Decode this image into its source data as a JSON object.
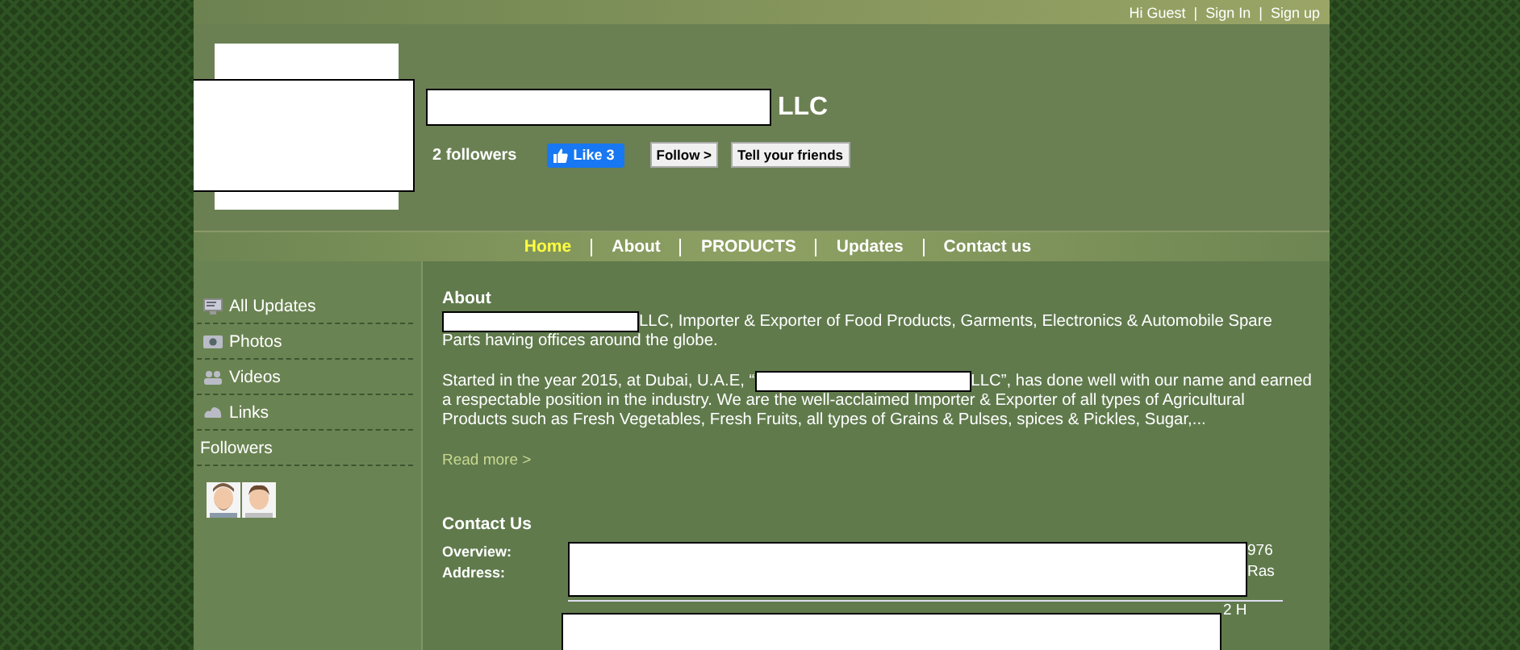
{
  "top_bar": {
    "greeting": "Hi Guest",
    "links": [
      "Sign In",
      "Sign up"
    ],
    "separators": [
      "|",
      "|"
    ]
  },
  "header": {
    "company_suffix": "LLC",
    "followers": "2 followers",
    "like_button": "Like 3",
    "buttons": [
      "Follow >",
      "Tell your friends"
    ]
  },
  "nav": [
    {
      "label": "Home",
      "selected": true
    },
    {
      "label": "About",
      "selected": false
    },
    {
      "label": "PRODUCTS",
      "selected": false
    },
    {
      "label": "Updates",
      "selected": false
    },
    {
      "label": "Contact us",
      "selected": false
    }
  ],
  "sidebar": {
    "items": [
      {
        "label": "All Updates",
        "kind": "updates"
      },
      {
        "label": "Photos",
        "kind": "photos"
      },
      {
        "label": "Videos",
        "kind": "videos"
      },
      {
        "label": "Links",
        "kind": "links"
      },
      {
        "label": "Followers",
        "kind": "plain"
      }
    ],
    "avatars": [
      {
        "kind": "bearded"
      },
      {
        "kind": "plain"
      }
    ]
  },
  "about": {
    "heading": "About",
    "paragraphs": [
      [
        [
          {
            "kind": "redacted"
          },
          {
            "kind": "text",
            "text": "LLC, Importer & Exporter of Food Products, Garments, Electronics & Automobile Spare"
          }
        ],
        [
          {
            "kind": "text",
            "text": "Parts having offices around the globe."
          }
        ]
      ],
      [
        [
          {
            "kind": "text",
            "text": "Started in the year 2015, at Dubai, U.A.E, “"
          },
          {
            "kind": "redacted"
          },
          {
            "kind": "text",
            "text": "LLC”, has done well with our name and earned"
          }
        ],
        [
          {
            "kind": "text",
            "text": "a respectable position in the industry. We are the well-acclaimed Importer & Exporter of all types of Agricultural"
          }
        ],
        [
          {
            "kind": "text",
            "text": "Products such as Fresh Vegetables, Fresh Fruits, all types of Grains & Pulses, spices & Pickles, Sugar,..."
          }
        ]
      ]
    ],
    "read_more": "Read more >"
  },
  "contact": {
    "heading": "Contact Us",
    "rows": [
      {
        "label": "Overview:",
        "value_tail": "976"
      },
      {
        "label": "Address:",
        "value_tail": "Ras"
      }
    ],
    "extra_tail": "2 H"
  }
}
